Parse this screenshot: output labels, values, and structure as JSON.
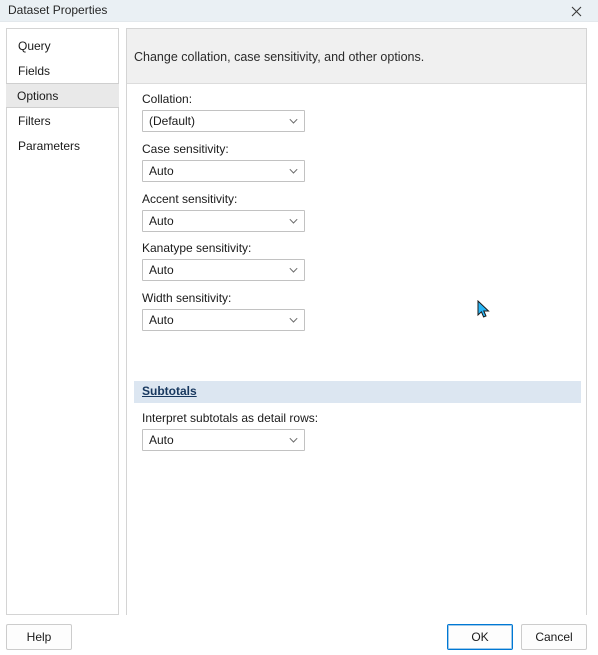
{
  "window": {
    "title": "Dataset Properties",
    "close_icon": "close-icon",
    "close_glyph": "✕"
  },
  "sidebar": {
    "items": [
      {
        "label": "Query",
        "selected": false
      },
      {
        "label": "Fields",
        "selected": false
      },
      {
        "label": "Options",
        "selected": true
      },
      {
        "label": "Filters",
        "selected": false
      },
      {
        "label": "Parameters",
        "selected": false
      }
    ]
  },
  "content": {
    "header": "Change collation, case sensitivity, and other options.",
    "fields": [
      {
        "label": "Collation:",
        "value": "(Default)"
      },
      {
        "label": "Case sensitivity:",
        "value": "Auto"
      },
      {
        "label": "Accent sensitivity:",
        "value": "Auto"
      },
      {
        "label": "Kanatype sensitivity:",
        "value": "Auto"
      },
      {
        "label": "Width sensitivity:",
        "value": "Auto"
      }
    ],
    "section": {
      "title": "Subtotals",
      "fields": [
        {
          "label": "Interpret subtotals as detail rows:",
          "value": "Auto"
        }
      ]
    }
  },
  "footer": {
    "help_label": "Help",
    "ok_label": "OK",
    "cancel_label": "Cancel"
  },
  "colors": {
    "titlebar_bg": "#eaf0f4",
    "header_bg": "#f0f0f0",
    "section_band_bg": "#dce6f1",
    "section_title_fg": "#17375e",
    "selection_bg": "#e9e9e9",
    "focus_accent": "#0078d4",
    "cursor": "#29b6f6"
  }
}
